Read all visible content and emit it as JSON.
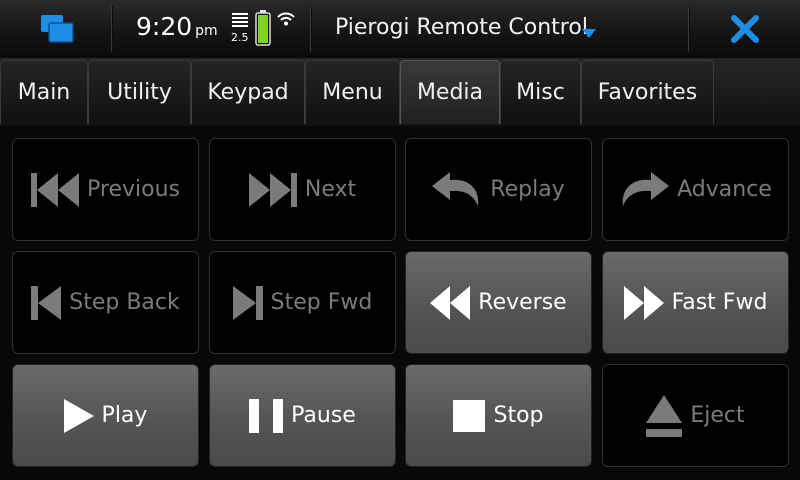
{
  "statusbar": {
    "time": "9:20",
    "ampm": "pm",
    "battery_indicator": "2.5",
    "app_title": "Pierogi Remote Control",
    "icons": {
      "task_switcher": "task-switcher-icon",
      "battery": "battery-icon",
      "wifi": "wifi-icon",
      "dropdown": "dropdown-arrow-icon",
      "close": "close-icon"
    },
    "colors": {
      "accent_blue": "#1e8fe8",
      "battery_green": "#7ed321"
    }
  },
  "tabs": [
    {
      "label": "Main"
    },
    {
      "label": "Utility"
    },
    {
      "label": "Keypad"
    },
    {
      "label": "Menu"
    },
    {
      "label": "Media",
      "active": true
    },
    {
      "label": "Misc"
    },
    {
      "label": "Favorites"
    }
  ],
  "buttons": [
    {
      "label": "Previous",
      "icon": "previous-icon",
      "enabled": false
    },
    {
      "label": "Next",
      "icon": "next-icon",
      "enabled": false
    },
    {
      "label": "Replay",
      "icon": "replay-icon",
      "enabled": false
    },
    {
      "label": "Advance",
      "icon": "advance-icon",
      "enabled": false
    },
    {
      "label": "Step Back",
      "icon": "step-back-icon",
      "enabled": false
    },
    {
      "label": "Step Fwd",
      "icon": "step-fwd-icon",
      "enabled": false
    },
    {
      "label": "Reverse",
      "icon": "reverse-icon",
      "enabled": true
    },
    {
      "label": "Fast Fwd",
      "icon": "fast-fwd-icon",
      "enabled": true
    },
    {
      "label": "Play",
      "icon": "play-icon",
      "enabled": true
    },
    {
      "label": "Pause",
      "icon": "pause-icon",
      "enabled": true
    },
    {
      "label": "Stop",
      "icon": "stop-icon",
      "enabled": true
    },
    {
      "label": "Eject",
      "icon": "eject-icon",
      "enabled": false
    }
  ]
}
